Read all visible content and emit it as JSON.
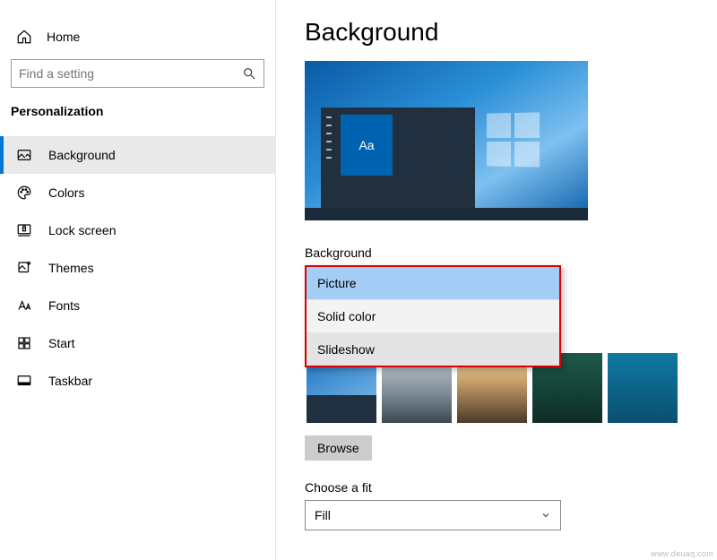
{
  "sidebar": {
    "home_label": "Home",
    "search_placeholder": "Find a setting",
    "section_title": "Personalization",
    "items": [
      {
        "label": "Background",
        "selected": true
      },
      {
        "label": "Colors"
      },
      {
        "label": "Lock screen"
      },
      {
        "label": "Themes"
      },
      {
        "label": "Fonts"
      },
      {
        "label": "Start"
      },
      {
        "label": "Taskbar"
      }
    ]
  },
  "main": {
    "title": "Background",
    "preview_sample_text": "Aa",
    "bg_label": "Background",
    "bg_options": [
      "Picture",
      "Solid color",
      "Slideshow"
    ],
    "bg_selected": "Picture",
    "browse_label": "Browse",
    "fit_label": "Choose a fit",
    "fit_value": "Fill"
  },
  "watermark": "www.deuaq.com"
}
